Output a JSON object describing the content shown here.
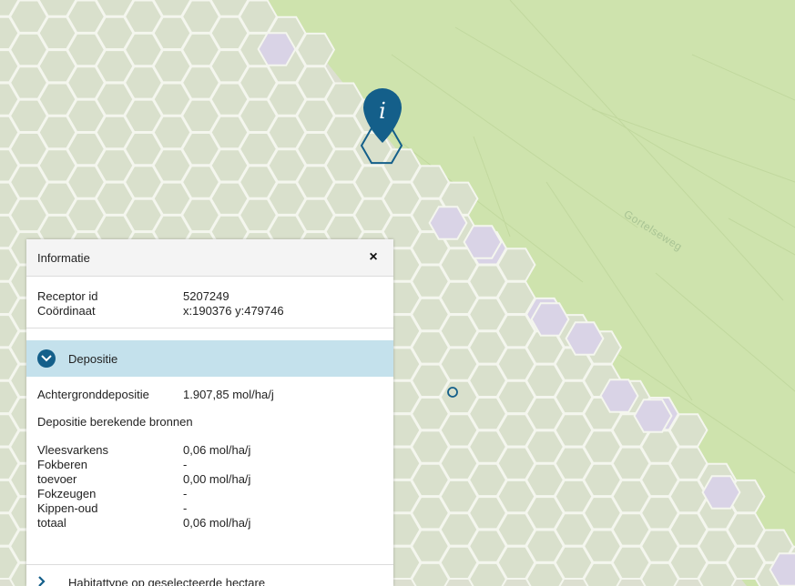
{
  "map": {
    "road_label": "Gortelseweg",
    "colors": {
      "base": "#dcdfd0",
      "grass": "#cee3ad",
      "hex_fill": "#d9e0cc",
      "hex_stroke": "#f4f6ee",
      "hex_purple": "#d9d3e6",
      "hex_green": "#c9e2a5",
      "marker": "#145f8a"
    },
    "marker_letter": "i"
  },
  "panel": {
    "title": "Informatie",
    "close_label": "×",
    "receptor": {
      "id_label": "Receptor id",
      "id_value": "5207249",
      "coord_label": "Coördinaat",
      "coord_value": "x:190376 y:479746"
    },
    "depositie": {
      "title": "Depositie",
      "achtergrond_label": "Achtergronddepositie",
      "achtergrond_value": "1.907,85 mol/ha/j",
      "berekend_label": "Depositie berekende bronnen",
      "sources": [
        {
          "name": "Vleesvarkens",
          "value": "0,06 mol/ha/j"
        },
        {
          "name": "Fokberen",
          "value": "-"
        },
        {
          "name": "toevoer",
          "value": "0,00 mol/ha/j"
        },
        {
          "name": "Fokzeugen",
          "value": "-"
        },
        {
          "name": "Kippen-oud",
          "value": "-"
        },
        {
          "name": "totaal",
          "value": "0,06 mol/ha/j"
        }
      ]
    },
    "habitattype": {
      "title": "Habitattype op geselecteerde hectare"
    }
  }
}
